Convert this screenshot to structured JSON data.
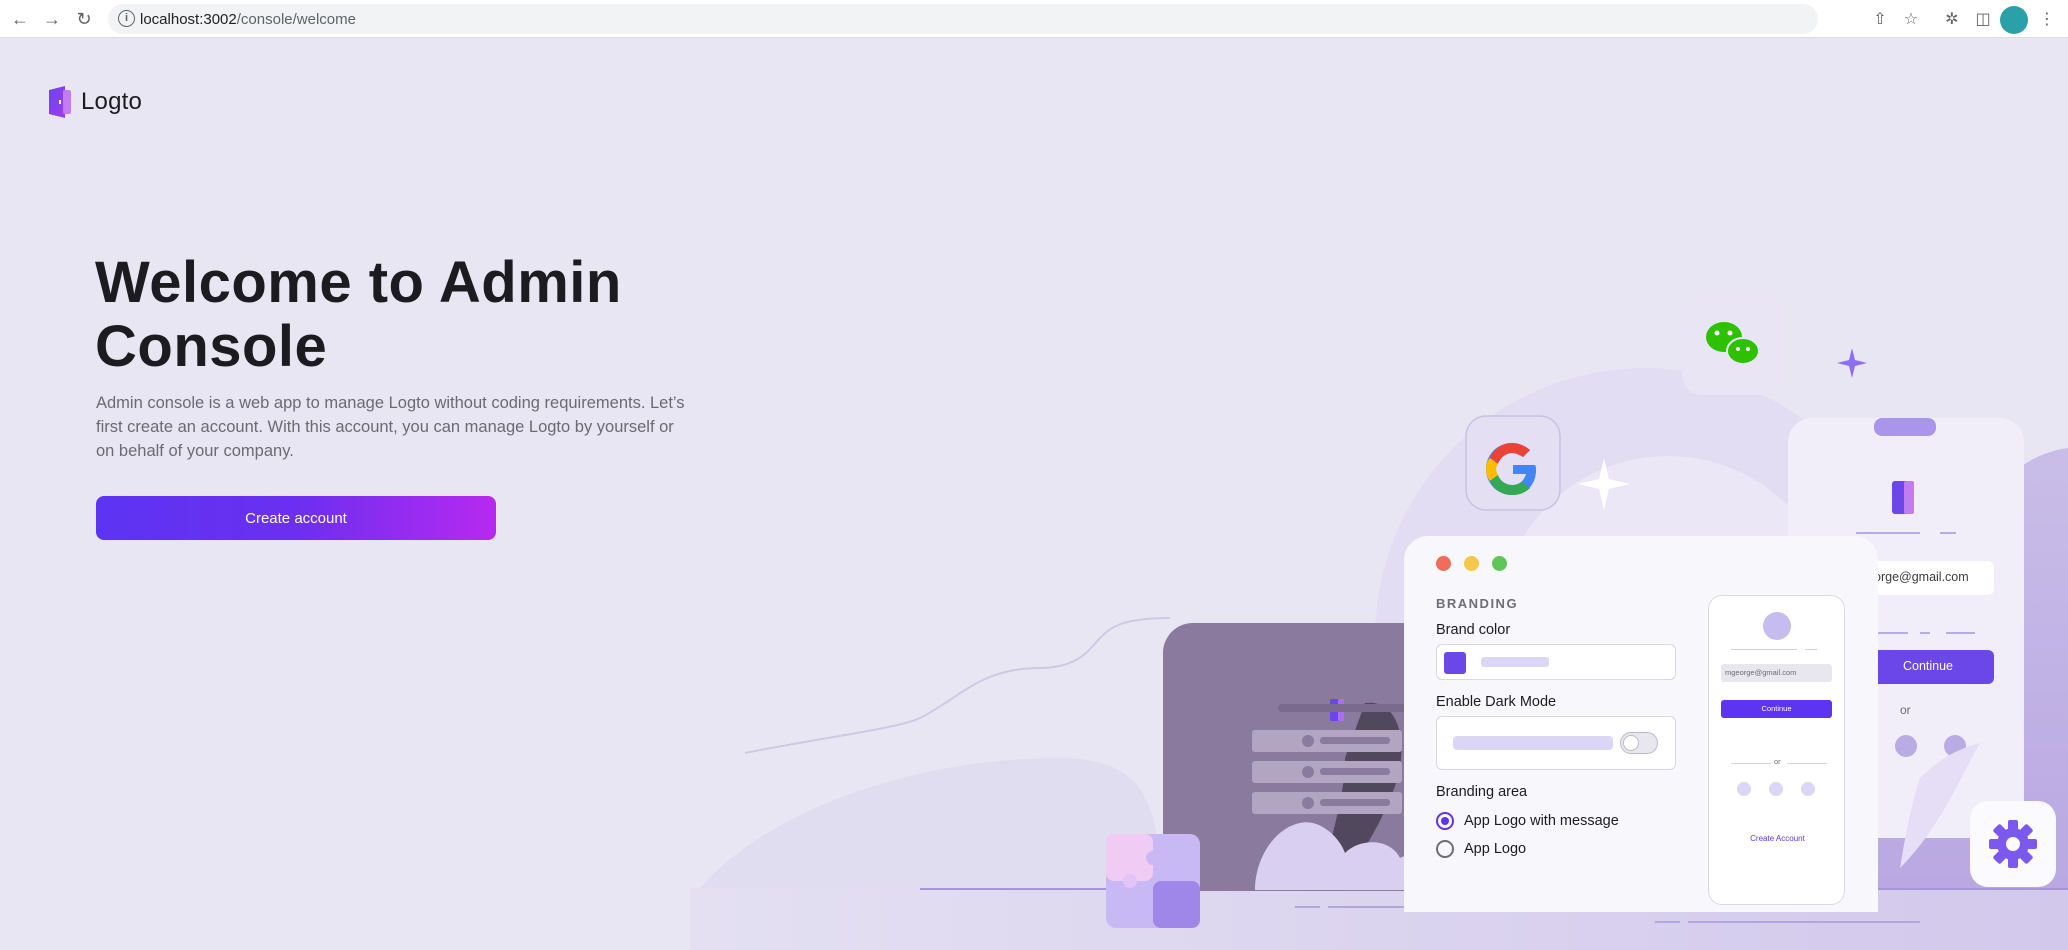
{
  "browser": {
    "url_host": "localhost:3002",
    "url_path": "/console/welcome"
  },
  "logo": {
    "text": "Logto"
  },
  "hero": {
    "title": "Welcome to Admin Console",
    "description": "Admin console is a web app to manage Logto without coding requirements. Let’s first create an account. With this account, you can manage Logto by yourself or on behalf of your company.",
    "create_button": "Create account"
  },
  "illustration": {
    "section_label": "BRANDING",
    "brand_color_label": "Brand color",
    "dark_mode_label": "Enable Dark Mode",
    "branding_area_label": "Branding area",
    "radio_options": [
      "App Logo with message",
      "App Logo"
    ],
    "phone_email": "mgeorge@gmail.com",
    "phone_continue": "Continue",
    "phone_or": "or",
    "phone_create_account": "Create Account",
    "back_email": "orge@gmail.com",
    "back_continue": "Continue",
    "back_or": "or"
  },
  "colors": {
    "accent": "#5d34f2",
    "accent_end": "#b829f0",
    "background": "#e9e6f4"
  }
}
